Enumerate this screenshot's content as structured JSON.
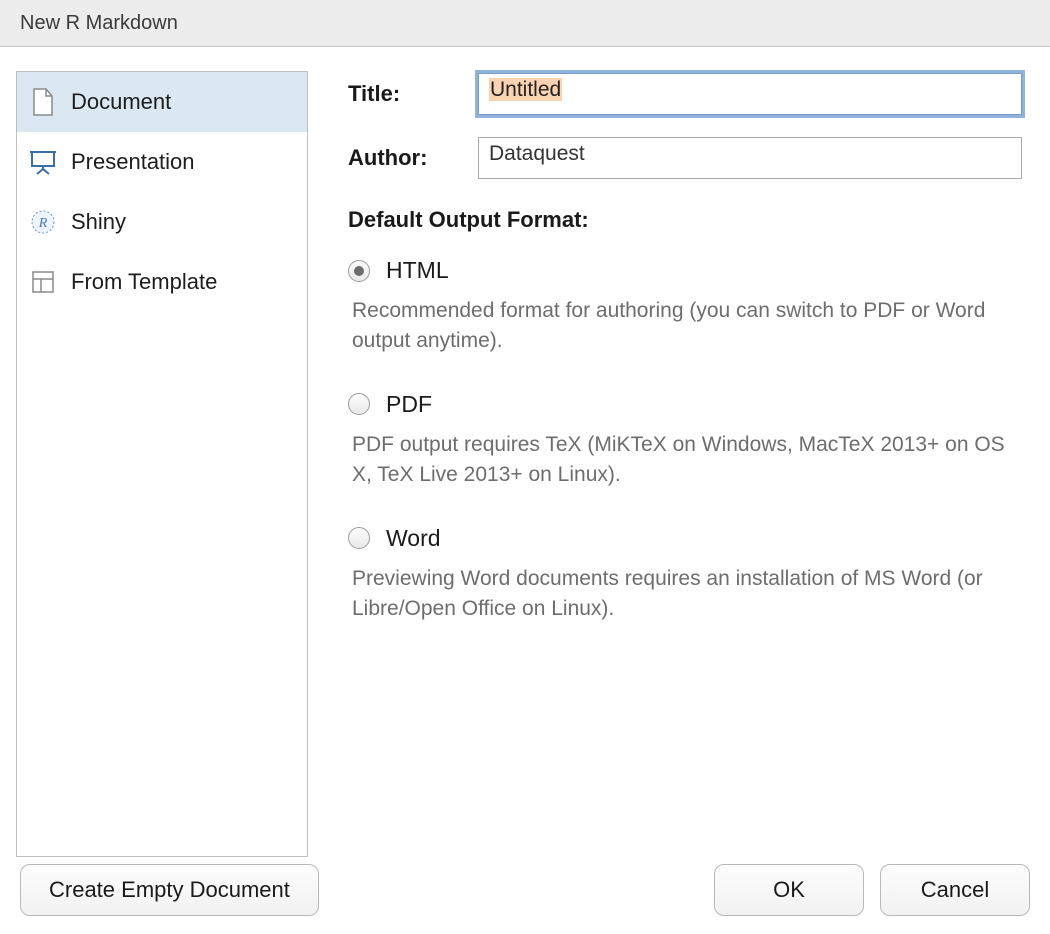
{
  "window": {
    "title": "New R Markdown"
  },
  "sidebar": {
    "items": [
      {
        "label": "Document",
        "selected": true
      },
      {
        "label": "Presentation",
        "selected": false
      },
      {
        "label": "Shiny",
        "selected": false
      },
      {
        "label": "From Template",
        "selected": false
      }
    ]
  },
  "form": {
    "title_label": "Title:",
    "title_value": "Untitled",
    "author_label": "Author:",
    "author_value": "Dataquest",
    "section_heading": "Default Output Format:"
  },
  "formats": [
    {
      "label": "HTML",
      "selected": true,
      "desc": "Recommended format for authoring (you can switch to PDF or Word output anytime)."
    },
    {
      "label": "PDF",
      "selected": false,
      "desc": "PDF output requires TeX (MiKTeX on Windows, MacTeX 2013+ on OS X, TeX Live 2013+ on Linux)."
    },
    {
      "label": "Word",
      "selected": false,
      "desc": "Previewing Word documents requires an installation of MS Word (or Libre/Open Office on Linux)."
    }
  ],
  "buttons": {
    "create_empty": "Create Empty Document",
    "ok": "OK",
    "cancel": "Cancel"
  }
}
